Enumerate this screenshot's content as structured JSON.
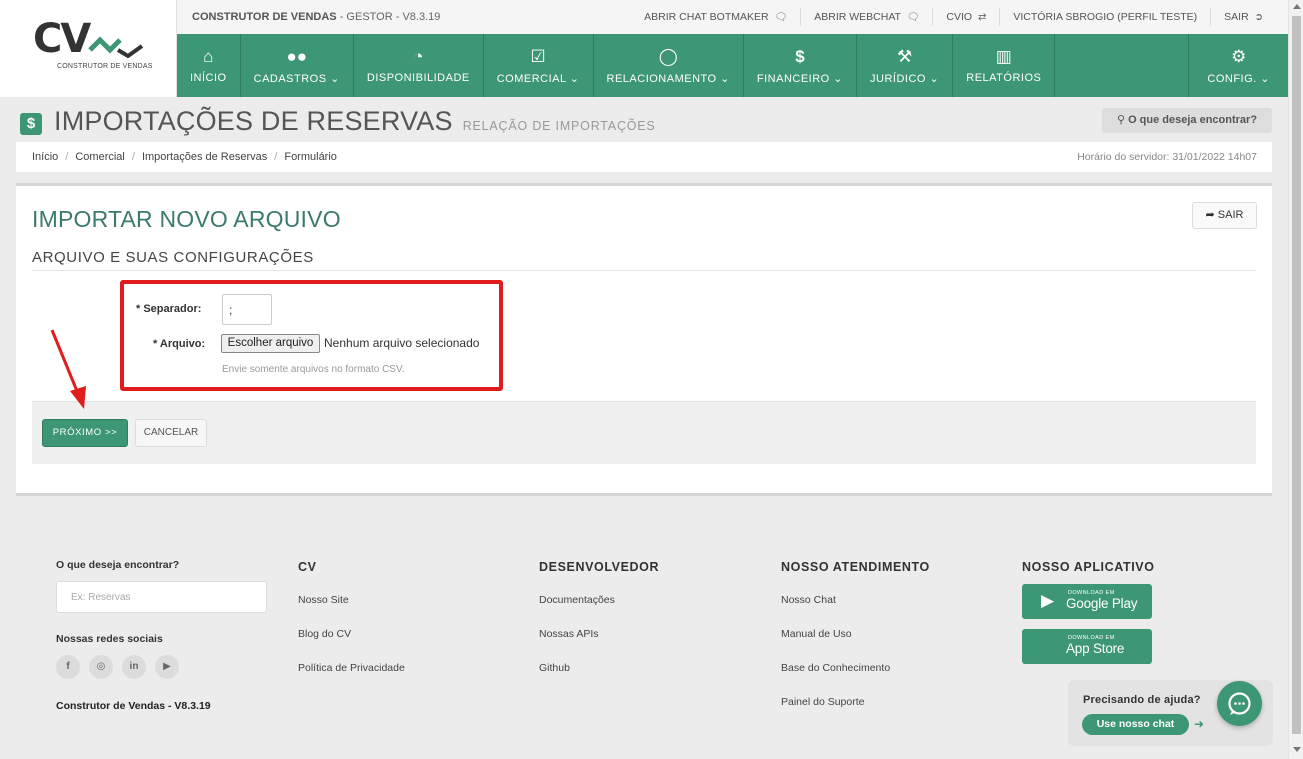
{
  "logo": {
    "mark": "CV",
    "tagline": "CONSTRUTOR DE VENDAS"
  },
  "sysbar": {
    "app_name": "CONSTRUTOR DE VENDAS",
    "app_meta": " - GESTOR - V8.3.19",
    "links": [
      {
        "label": "ABRIR CHAT BOTMAKER",
        "icon": "chat-icon"
      },
      {
        "label": "ABRIR WEBCHAT",
        "icon": "chat-icon"
      },
      {
        "label": "CVIO",
        "icon": "exchange-icon"
      },
      {
        "label": "VICTÓRIA SBROGIO (PERFIL TESTE)",
        "icon": ""
      },
      {
        "label": "SAIR",
        "icon": "sign-out-icon"
      }
    ]
  },
  "nav": {
    "items": [
      {
        "label": "INÍCIO",
        "icon": "⌂",
        "icon_name": "home-icon",
        "caret": ""
      },
      {
        "label": "CADASTROS",
        "icon": "●●",
        "icon_name": "users-icon",
        "caret": "⌄"
      },
      {
        "label": "DISPONIBILIDADE",
        "icon": "◔",
        "icon_name": "dashboard-icon",
        "caret": ""
      },
      {
        "label": "COMERCIAL",
        "icon": "☑",
        "icon_name": "check-square-icon",
        "caret": "⌄"
      },
      {
        "label": "RELACIONAMENTO",
        "icon": "◯",
        "icon_name": "comments-icon",
        "caret": "⌄"
      },
      {
        "label": "FINANCEIRO",
        "icon": "$",
        "icon_name": "dollar-icon",
        "caret": "⌄"
      },
      {
        "label": "JURÍDICO",
        "icon": "⚒",
        "icon_name": "gavel-icon",
        "caret": "⌄"
      },
      {
        "label": "RELATÓRIOS",
        "icon": "▥",
        "icon_name": "bar-chart-icon",
        "caret": ""
      }
    ],
    "config": {
      "label": "CONFIG.",
      "icon": "⚙",
      "caret": "⌄"
    }
  },
  "page": {
    "title": "IMPORTAÇÕES DE RESERVAS",
    "subtitle": "RELAÇÃO DE IMPORTAÇÕES",
    "search_label": "O que deseja encontrar?"
  },
  "breadcrumb": {
    "items": [
      "Início",
      "Comercial",
      "Importações de Reservas",
      "Formulário"
    ],
    "server_time": "Horário do servidor: 31/01/2022 14h07"
  },
  "form": {
    "heading": "IMPORTAR NOVO ARQUIVO",
    "exit_label": "SAIR",
    "section": "ARQUIVO E SUAS CONFIGURAÇÕES",
    "separator_label": "* Separador:",
    "separator_value": ";",
    "file_label": "* Arquivo:",
    "file_button": "Escolher arquivo",
    "file_status": "Nenhum arquivo selecionado",
    "hint": "Envie somente arquivos no formato CSV.",
    "next_label": "PRÓXIMO >>",
    "cancel_label": "CANCELAR"
  },
  "footer": {
    "search_label": "O que deseja encontrar?",
    "search_placeholder": "Ex: Reservas",
    "social_label": "Nossas redes sociais",
    "socials": [
      "f",
      "◎",
      "in",
      "▶"
    ],
    "version": "Construtor de Vendas - V8.3.19",
    "columns": [
      {
        "title": "CV",
        "links": [
          "Nosso Site",
          "Blog do CV",
          "Política de Privacidade"
        ]
      },
      {
        "title": "DESENVOLVEDOR",
        "links": [
          "Documentações",
          "Nossas APIs",
          "Github"
        ]
      },
      {
        "title": "NOSSO ATENDIMENTO",
        "links": [
          "Nosso Chat",
          "Manual de Uso",
          "Base do Conhecimento",
          "Painel do Suporte"
        ]
      }
    ],
    "app_title": "NOSSO APLICATIVO",
    "stores": [
      {
        "small": "DOWNLOAD EM",
        "large": "Google Play",
        "icon": "▶"
      },
      {
        "small": "DOWNLOAD EM",
        "large": "App Store",
        "icon": ""
      }
    ],
    "help_title": "Precisando de ajuda?",
    "help_button": "Use nosso chat"
  },
  "colors": {
    "brand_green": "#3d9775",
    "highlight_red": "#e01c1c",
    "title_teal": "#3b7a6e"
  }
}
